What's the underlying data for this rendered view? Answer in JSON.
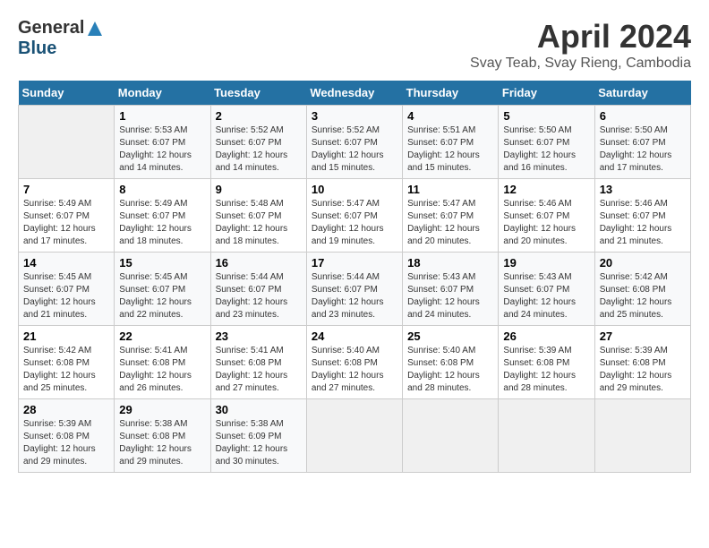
{
  "logo": {
    "general": "General",
    "blue": "Blue"
  },
  "title": {
    "month_year": "April 2024",
    "location": "Svay Teab, Svay Rieng, Cambodia"
  },
  "days_of_week": [
    "Sunday",
    "Monday",
    "Tuesday",
    "Wednesday",
    "Thursday",
    "Friday",
    "Saturday"
  ],
  "weeks": [
    [
      {
        "day": "",
        "sunrise": "",
        "sunset": "",
        "daylight": ""
      },
      {
        "day": "1",
        "sunrise": "Sunrise: 5:53 AM",
        "sunset": "Sunset: 6:07 PM",
        "daylight": "Daylight: 12 hours and 14 minutes."
      },
      {
        "day": "2",
        "sunrise": "Sunrise: 5:52 AM",
        "sunset": "Sunset: 6:07 PM",
        "daylight": "Daylight: 12 hours and 14 minutes."
      },
      {
        "day": "3",
        "sunrise": "Sunrise: 5:52 AM",
        "sunset": "Sunset: 6:07 PM",
        "daylight": "Daylight: 12 hours and 15 minutes."
      },
      {
        "day": "4",
        "sunrise": "Sunrise: 5:51 AM",
        "sunset": "Sunset: 6:07 PM",
        "daylight": "Daylight: 12 hours and 15 minutes."
      },
      {
        "day": "5",
        "sunrise": "Sunrise: 5:50 AM",
        "sunset": "Sunset: 6:07 PM",
        "daylight": "Daylight: 12 hours and 16 minutes."
      },
      {
        "day": "6",
        "sunrise": "Sunrise: 5:50 AM",
        "sunset": "Sunset: 6:07 PM",
        "daylight": "Daylight: 12 hours and 17 minutes."
      }
    ],
    [
      {
        "day": "7",
        "sunrise": "Sunrise: 5:49 AM",
        "sunset": "Sunset: 6:07 PM",
        "daylight": "Daylight: 12 hours and 17 minutes."
      },
      {
        "day": "8",
        "sunrise": "Sunrise: 5:49 AM",
        "sunset": "Sunset: 6:07 PM",
        "daylight": "Daylight: 12 hours and 18 minutes."
      },
      {
        "day": "9",
        "sunrise": "Sunrise: 5:48 AM",
        "sunset": "Sunset: 6:07 PM",
        "daylight": "Daylight: 12 hours and 18 minutes."
      },
      {
        "day": "10",
        "sunrise": "Sunrise: 5:47 AM",
        "sunset": "Sunset: 6:07 PM",
        "daylight": "Daylight: 12 hours and 19 minutes."
      },
      {
        "day": "11",
        "sunrise": "Sunrise: 5:47 AM",
        "sunset": "Sunset: 6:07 PM",
        "daylight": "Daylight: 12 hours and 20 minutes."
      },
      {
        "day": "12",
        "sunrise": "Sunrise: 5:46 AM",
        "sunset": "Sunset: 6:07 PM",
        "daylight": "Daylight: 12 hours and 20 minutes."
      },
      {
        "day": "13",
        "sunrise": "Sunrise: 5:46 AM",
        "sunset": "Sunset: 6:07 PM",
        "daylight": "Daylight: 12 hours and 21 minutes."
      }
    ],
    [
      {
        "day": "14",
        "sunrise": "Sunrise: 5:45 AM",
        "sunset": "Sunset: 6:07 PM",
        "daylight": "Daylight: 12 hours and 21 minutes."
      },
      {
        "day": "15",
        "sunrise": "Sunrise: 5:45 AM",
        "sunset": "Sunset: 6:07 PM",
        "daylight": "Daylight: 12 hours and 22 minutes."
      },
      {
        "day": "16",
        "sunrise": "Sunrise: 5:44 AM",
        "sunset": "Sunset: 6:07 PM",
        "daylight": "Daylight: 12 hours and 23 minutes."
      },
      {
        "day": "17",
        "sunrise": "Sunrise: 5:44 AM",
        "sunset": "Sunset: 6:07 PM",
        "daylight": "Daylight: 12 hours and 23 minutes."
      },
      {
        "day": "18",
        "sunrise": "Sunrise: 5:43 AM",
        "sunset": "Sunset: 6:07 PM",
        "daylight": "Daylight: 12 hours and 24 minutes."
      },
      {
        "day": "19",
        "sunrise": "Sunrise: 5:43 AM",
        "sunset": "Sunset: 6:07 PM",
        "daylight": "Daylight: 12 hours and 24 minutes."
      },
      {
        "day": "20",
        "sunrise": "Sunrise: 5:42 AM",
        "sunset": "Sunset: 6:08 PM",
        "daylight": "Daylight: 12 hours and 25 minutes."
      }
    ],
    [
      {
        "day": "21",
        "sunrise": "Sunrise: 5:42 AM",
        "sunset": "Sunset: 6:08 PM",
        "daylight": "Daylight: 12 hours and 25 minutes."
      },
      {
        "day": "22",
        "sunrise": "Sunrise: 5:41 AM",
        "sunset": "Sunset: 6:08 PM",
        "daylight": "Daylight: 12 hours and 26 minutes."
      },
      {
        "day": "23",
        "sunrise": "Sunrise: 5:41 AM",
        "sunset": "Sunset: 6:08 PM",
        "daylight": "Daylight: 12 hours and 27 minutes."
      },
      {
        "day": "24",
        "sunrise": "Sunrise: 5:40 AM",
        "sunset": "Sunset: 6:08 PM",
        "daylight": "Daylight: 12 hours and 27 minutes."
      },
      {
        "day": "25",
        "sunrise": "Sunrise: 5:40 AM",
        "sunset": "Sunset: 6:08 PM",
        "daylight": "Daylight: 12 hours and 28 minutes."
      },
      {
        "day": "26",
        "sunrise": "Sunrise: 5:39 AM",
        "sunset": "Sunset: 6:08 PM",
        "daylight": "Daylight: 12 hours and 28 minutes."
      },
      {
        "day": "27",
        "sunrise": "Sunrise: 5:39 AM",
        "sunset": "Sunset: 6:08 PM",
        "daylight": "Daylight: 12 hours and 29 minutes."
      }
    ],
    [
      {
        "day": "28",
        "sunrise": "Sunrise: 5:39 AM",
        "sunset": "Sunset: 6:08 PM",
        "daylight": "Daylight: 12 hours and 29 minutes."
      },
      {
        "day": "29",
        "sunrise": "Sunrise: 5:38 AM",
        "sunset": "Sunset: 6:08 PM",
        "daylight": "Daylight: 12 hours and 29 minutes."
      },
      {
        "day": "30",
        "sunrise": "Sunrise: 5:38 AM",
        "sunset": "Sunset: 6:09 PM",
        "daylight": "Daylight: 12 hours and 30 minutes."
      },
      {
        "day": "",
        "sunrise": "",
        "sunset": "",
        "daylight": ""
      },
      {
        "day": "",
        "sunrise": "",
        "sunset": "",
        "daylight": ""
      },
      {
        "day": "",
        "sunrise": "",
        "sunset": "",
        "daylight": ""
      },
      {
        "day": "",
        "sunrise": "",
        "sunset": "",
        "daylight": ""
      }
    ]
  ]
}
